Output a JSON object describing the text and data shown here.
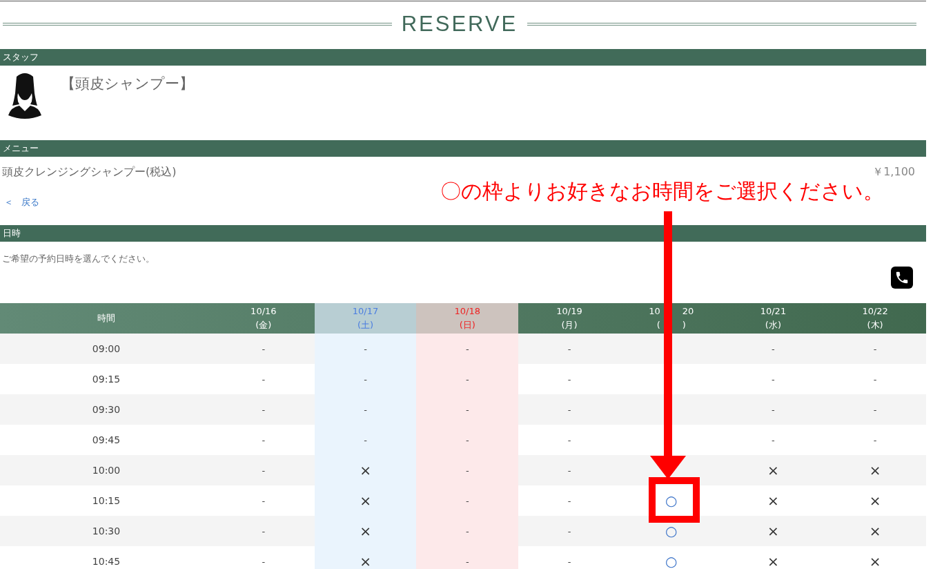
{
  "title": "RESERVE",
  "staff": {
    "heading": "スタッフ",
    "name": "【頭皮シャンプー】"
  },
  "menu": {
    "heading": "メニュー",
    "item": "頭皮クレンジングシャンプー(税込)",
    "price": "￥1,100",
    "back_icon": "＜",
    "back_link": "戻る"
  },
  "datetime": {
    "heading": "日時",
    "description": "ご希望の予約日時を選んでください。"
  },
  "annotation": {
    "text": "〇の枠よりお好きなお時間をご選択ください。"
  },
  "table": {
    "time_heading": "時間",
    "columns": [
      {
        "date": "10/16",
        "weekday": "(金)",
        "kind": "weekday"
      },
      {
        "date": "10/17",
        "weekday": "(土)",
        "kind": "saturday"
      },
      {
        "date": "10/18",
        "weekday": "(日)",
        "kind": "sunday"
      },
      {
        "date": "10/19",
        "weekday": "(月)",
        "kind": "weekday"
      },
      {
        "date": [
          "10",
          "20"
        ],
        "weekday": [
          "(",
          ")"
        ],
        "kind": "weekday"
      },
      {
        "date": "10/21",
        "weekday": "(水)",
        "kind": "weekday"
      },
      {
        "date": "10/22",
        "weekday": "(木)",
        "kind": "weekday"
      }
    ],
    "rows": [
      {
        "time": "09:00",
        "cells": [
          {
            "kind": "closed",
            "text": "-"
          },
          {
            "kind": "closed",
            "text": "-"
          },
          {
            "kind": "closed",
            "text": "-"
          },
          {
            "kind": "closed",
            "text": "-"
          },
          {
            "kind": "covered"
          },
          {
            "kind": "closed",
            "text": "-"
          },
          {
            "kind": "closed",
            "text": "-"
          }
        ]
      },
      {
        "time": "09:15",
        "cells": [
          {
            "kind": "closed",
            "text": "-"
          },
          {
            "kind": "closed",
            "text": "-"
          },
          {
            "kind": "closed",
            "text": "-"
          },
          {
            "kind": "closed",
            "text": "-"
          },
          {
            "kind": "covered"
          },
          {
            "kind": "closed",
            "text": "-"
          },
          {
            "kind": "closed",
            "text": "-"
          }
        ]
      },
      {
        "time": "09:30",
        "cells": [
          {
            "kind": "closed",
            "text": "-"
          },
          {
            "kind": "closed",
            "text": "-"
          },
          {
            "kind": "closed",
            "text": "-"
          },
          {
            "kind": "closed",
            "text": "-"
          },
          {
            "kind": "covered"
          },
          {
            "kind": "closed",
            "text": "-"
          },
          {
            "kind": "closed",
            "text": "-"
          }
        ]
      },
      {
        "time": "09:45",
        "cells": [
          {
            "kind": "closed",
            "text": "-"
          },
          {
            "kind": "closed",
            "text": "-"
          },
          {
            "kind": "closed",
            "text": "-"
          },
          {
            "kind": "closed",
            "text": "-"
          },
          {
            "kind": "covered"
          },
          {
            "kind": "closed",
            "text": "-"
          },
          {
            "kind": "closed",
            "text": "-"
          }
        ]
      },
      {
        "time": "10:00",
        "cells": [
          {
            "kind": "closed",
            "text": "-"
          },
          {
            "kind": "full",
            "text": "×"
          },
          {
            "kind": "closed",
            "text": "-"
          },
          {
            "kind": "closed",
            "text": "-"
          },
          {
            "kind": "covered"
          },
          {
            "kind": "full",
            "text": "×"
          },
          {
            "kind": "full",
            "text": "×"
          }
        ]
      },
      {
        "time": "10:15",
        "cells": [
          {
            "kind": "closed",
            "text": "-"
          },
          {
            "kind": "full",
            "text": "×"
          },
          {
            "kind": "closed",
            "text": "-"
          },
          {
            "kind": "closed",
            "text": "-"
          },
          {
            "kind": "open",
            "text": "○"
          },
          {
            "kind": "full",
            "text": "×"
          },
          {
            "kind": "full",
            "text": "×"
          }
        ]
      },
      {
        "time": "10:30",
        "cells": [
          {
            "kind": "closed",
            "text": "-"
          },
          {
            "kind": "full",
            "text": "×"
          },
          {
            "kind": "closed",
            "text": "-"
          },
          {
            "kind": "closed",
            "text": "-"
          },
          {
            "kind": "open",
            "text": "○"
          },
          {
            "kind": "full",
            "text": "×"
          },
          {
            "kind": "full",
            "text": "×"
          }
        ]
      },
      {
        "time": "10:45",
        "cells": [
          {
            "kind": "closed",
            "text": "-"
          },
          {
            "kind": "full",
            "text": "×"
          },
          {
            "kind": "closed",
            "text": "-"
          },
          {
            "kind": "closed",
            "text": "-"
          },
          {
            "kind": "open",
            "text": "○"
          },
          {
            "kind": "full",
            "text": "×"
          },
          {
            "kind": "full",
            "text": "×"
          }
        ]
      }
    ]
  }
}
